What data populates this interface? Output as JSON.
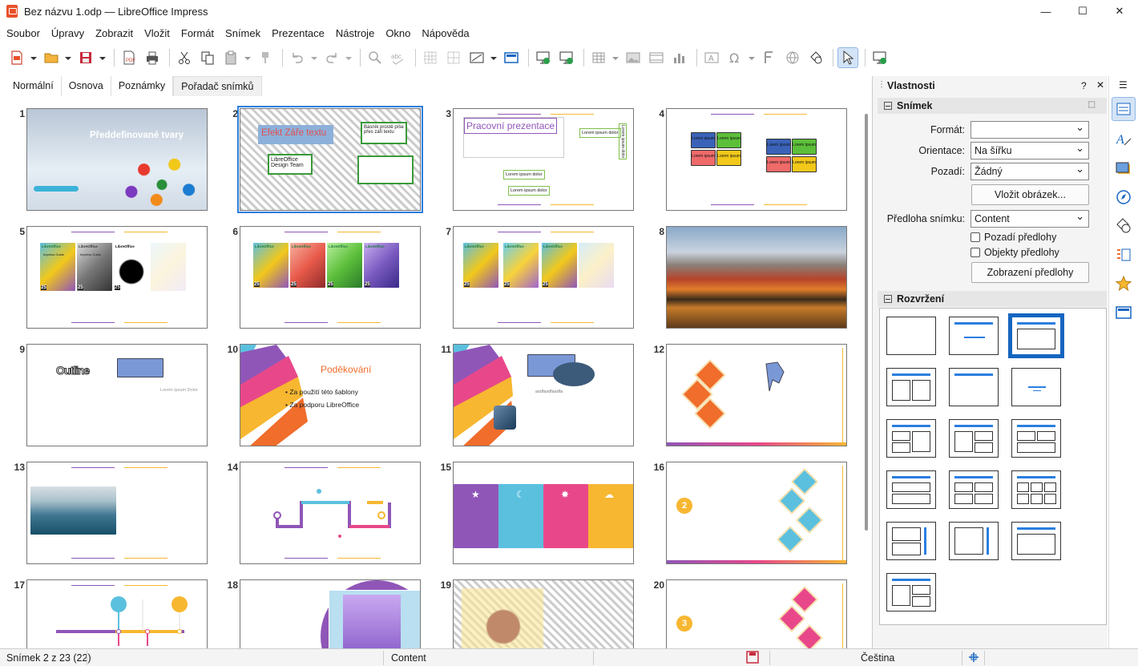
{
  "window": {
    "title": "Bez názvu 1.odp — LibreOffice Impress",
    "minimize": "—",
    "maximize": "☐",
    "close": "✕"
  },
  "menu": [
    "Soubor",
    "Úpravy",
    "Zobrazit",
    "Vložit",
    "Formát",
    "Snímek",
    "Prezentace",
    "Nástroje",
    "Okno",
    "Nápověda"
  ],
  "view_tabs": [
    "Normální",
    "Osnova",
    "Poznámky",
    "Pořadač snímků"
  ],
  "slide_numbers": [
    "1",
    "2",
    "3",
    "4",
    "5",
    "6",
    "7",
    "8",
    "9",
    "10",
    "11",
    "12",
    "13",
    "14",
    "15",
    "16",
    "17",
    "18",
    "19",
    "20"
  ],
  "slides": {
    "s1_title": "Předdefinované tvary",
    "s2_title": "Efekt Záře textu",
    "s2_box": "LibreOffice Design Team",
    "s2_side": "Básník prostě píše přes záři textu",
    "s3_title": "Pracovní prezentace",
    "s3_callout": "Lorem ipsum dolor",
    "s3_label1": "Lorem ipsum dolor",
    "s3_label2": "Lorem ipsum dolor",
    "s3_side": "Lorem ipsum dolor",
    "s4_box": "Lorem ipsum",
    "s9_outline": "Outline",
    "s9_caption": "Lorem Ipsum Dolor",
    "s10_title": "Poděkování",
    "s10_b1": "Za použití této šablony",
    "s10_b2": "Za podporu LibreOffice",
    "s11_caption": "asdfasdfasdfa",
    "s16_badge": "2",
    "s20_badge": "3",
    "lo_logo": "LibreOffice",
    "cover_label": "Impress Guide",
    "cover_num": "25"
  },
  "properties": {
    "title": "Vlastnosti",
    "help": "?",
    "close": "✕",
    "menu": "☰",
    "section_slide": "Snímek",
    "format_label": "Formát:",
    "format_value": "",
    "orientation_label": "Orientace:",
    "orientation_value": "Na šířku",
    "background_label": "Pozadí:",
    "background_value": "Žádný",
    "insert_image": "Vložit obrázek...",
    "master_label": "Předloha snímku:",
    "master_value": "Content",
    "master_background": "Pozadí předlohy",
    "master_objects": "Objekty předlohy",
    "show_master": "Zobrazení předlohy",
    "section_layout": "Rozvržení"
  },
  "status": {
    "slide": "Snímek 2 z 23 (22)",
    "master": "Content",
    "language": "Čeština"
  },
  "colors": {
    "accent": "#2a7ee0",
    "purple": "#8f56b8",
    "pink": "#e8488a",
    "yellow": "#f7b731",
    "cyan": "#5bc0de",
    "orange": "#f06d2b"
  }
}
